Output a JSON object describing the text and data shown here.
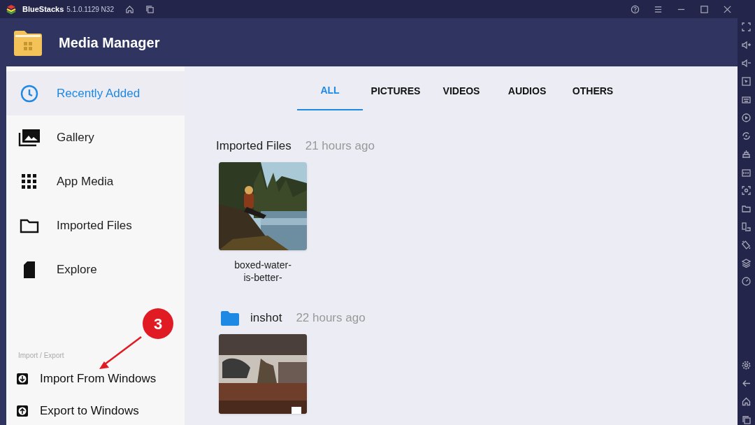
{
  "title_bar": {
    "app_name": "BlueStacks",
    "version": "5.1.0.1129 N32"
  },
  "header": {
    "title": "Media Manager"
  },
  "sidebar": {
    "items": [
      {
        "label": "Recently Added",
        "kind": "recent",
        "selected": true
      },
      {
        "label": "Gallery",
        "kind": "gallery",
        "selected": false
      },
      {
        "label": "App Media",
        "kind": "apps",
        "selected": false
      },
      {
        "label": "Imported Files",
        "kind": "imported",
        "selected": false
      },
      {
        "label": "Explore",
        "kind": "explore",
        "selected": false
      }
    ],
    "section_label": "Import / Export",
    "actions": [
      {
        "label": "Import From Windows",
        "kind": "import"
      },
      {
        "label": "Export to Windows",
        "kind": "export"
      }
    ]
  },
  "annotation": {
    "badge": "3"
  },
  "tabs": [
    {
      "label": "ALL",
      "selected": true
    },
    {
      "label": "PICTURES",
      "selected": false
    },
    {
      "label": "VIDEOS",
      "selected": false
    },
    {
      "label": "AUDIOS",
      "selected": false
    },
    {
      "label": "OTHERS",
      "selected": false
    }
  ],
  "groups": [
    {
      "kind": "plain",
      "title": "Imported Files",
      "time": "21 hours ago",
      "items": [
        {
          "kind": "picture",
          "caption": "boxed-water-\nis-better-"
        }
      ]
    },
    {
      "kind": "folder",
      "title": "inshot",
      "time": "22 hours ago",
      "items": [
        {
          "kind": "video"
        }
      ]
    }
  ]
}
